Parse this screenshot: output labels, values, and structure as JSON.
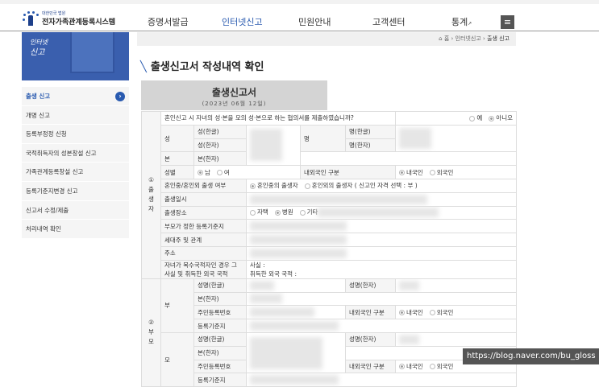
{
  "header": {
    "logo_sub": "대한민국 법원",
    "logo_main": "전자가족관계등록시스템",
    "nav": [
      "증명서발급",
      "인터넷신고",
      "민원안내",
      "고객센터",
      "통계"
    ],
    "active_nav": "인터넷신고",
    "menu_icon": "≡"
  },
  "banner": {
    "line1": "인터넷",
    "line2": "신고"
  },
  "sidebar": {
    "items": [
      "출생 신고",
      "개명 신고",
      "등록부정정 신청",
      "국적취득자의 성본창설 신고",
      "가족관계등록창설 신고",
      "등록기준지변경 신고",
      "신고서 수정/제출",
      "처리내역 확인"
    ],
    "active": "출생 신고"
  },
  "breadcrumb": {
    "home": "홈",
    "level1": "인터넷신고",
    "level2": "출생 신고"
  },
  "page_title": "출생신고서 작성내역 확인",
  "form": {
    "title": "출생신고서",
    "date": "(2023년 06월 12일)",
    "child": {
      "section": "① 출 생 자",
      "question": "혼인신고 시 자녀의 성·본을 모의 성·본으로 하는 협의서를 제출하였습니까?",
      "yes": "예",
      "no": "아니오",
      "surname": "성",
      "surname_hangul": "성(한글)",
      "surname_hanja": "성(한자)",
      "given": "명",
      "given_hangul": "명(한글)",
      "given_hanja": "명(한자)",
      "bon": "본",
      "bon_hanja": "본(한자)",
      "sex": "성별",
      "male": "남",
      "female": "여",
      "nationality": "내외국인 구분",
      "domestic": "내국인",
      "foreign": "외국인",
      "marital": "혼인중/혼인외 출생 여부",
      "in_marriage": "혼인중의 출생자",
      "out_marriage": "혼인외의 출생자",
      "qualification": "( 신고인 자격 선택 :  부 )",
      "birth_datetime": "출생일시",
      "birth_place": "출생장소",
      "home": "자택",
      "hospital": "병원",
      "other": "기타",
      "reg_base": "부모가 정한 등록기준지",
      "householder": "세대주 및 관계",
      "address": "주소",
      "dual": "자녀가 복수국적자인 경우 그 사실 및 취득한 외국 국적",
      "fact": "사실 :",
      "foreign_nat": "취득한 외국 국적 :"
    },
    "parents": {
      "section": "② 부 모",
      "father": "부",
      "mother": "모",
      "name_hangul": "성명(한글)",
      "name_hanja": "성명(한자)",
      "bon_hanja": "본(한자)",
      "rrn": "주민등록번호",
      "nationality": "내외국인 구분",
      "domestic": "내국인",
      "foreign": "외국인",
      "reg_base": "등록기준지"
    }
  },
  "watermark": "https://blog.naver.com/bu_gloss"
}
